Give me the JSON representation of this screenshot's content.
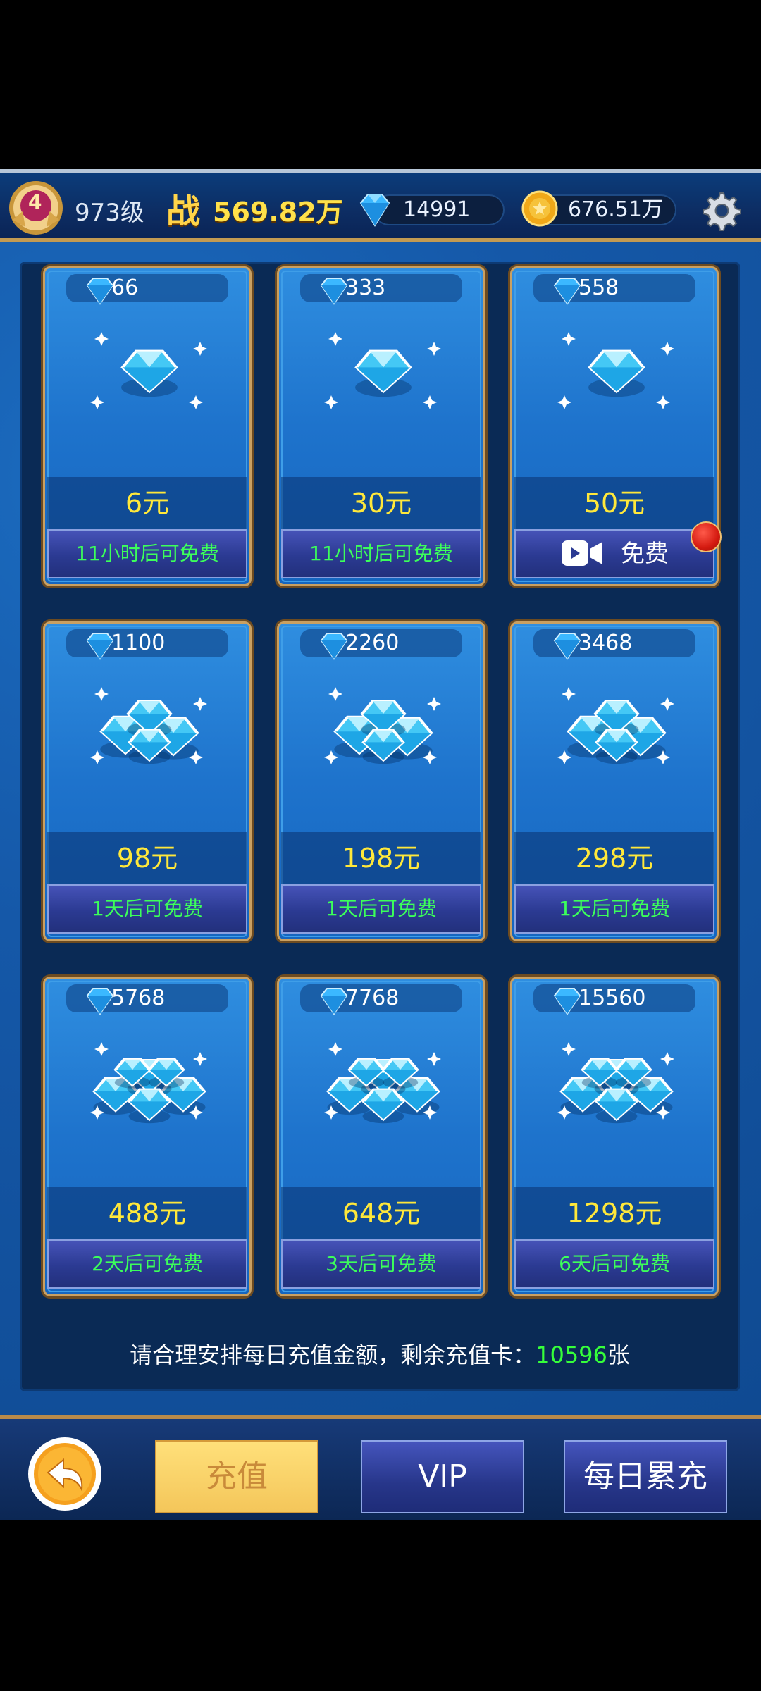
{
  "header": {
    "vip_level": "4",
    "player_level": "973级",
    "power_label": "战",
    "power_value": "569.82万",
    "gems": "14991",
    "coins": "676.51万"
  },
  "cards": [
    {
      "amount": "66",
      "price": "6元",
      "action": "11小时后可免费"
    },
    {
      "amount": "333",
      "price": "30元",
      "action": "11小时后可免费"
    },
    {
      "amount": "558",
      "price": "50元",
      "action": "免费"
    },
    {
      "amount": "1100",
      "price": "98元",
      "action": "1天后可免费"
    },
    {
      "amount": "2260",
      "price": "198元",
      "action": "1天后可免费"
    },
    {
      "amount": "3468",
      "price": "298元",
      "action": "1天后可免费"
    },
    {
      "amount": "5768",
      "price": "488元",
      "action": "2天后可免费"
    },
    {
      "amount": "7768",
      "price": "648元",
      "action": "3天后可免费"
    },
    {
      "amount": "15560",
      "price": "1298元",
      "action": "6天后可免费"
    }
  ],
  "footer": {
    "note_prefix": "请合理安排每日充值金额，剩余充值卡：",
    "cards_left": "10596",
    "note_suffix": "张"
  },
  "bottom_nav": {
    "recharge": "充值",
    "vip": "VIP",
    "daily": "每日累充"
  },
  "colors": {
    "accent_green": "#36ff3a",
    "price_yellow": "#ffe83a",
    "gold_border": "#c9a062"
  }
}
